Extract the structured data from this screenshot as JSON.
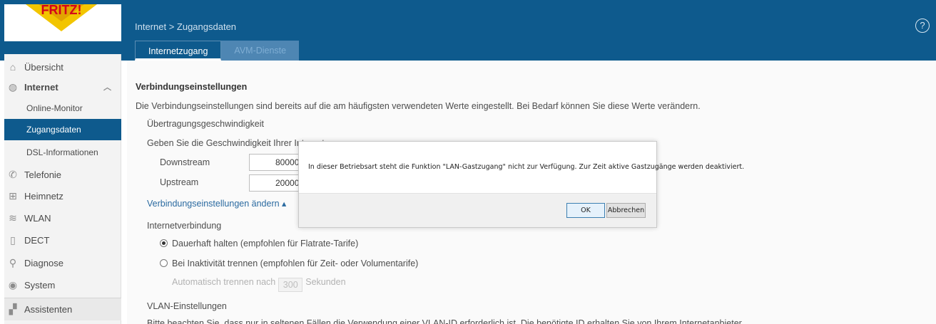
{
  "header": {
    "breadcrumb": "Internet > Zugangsdaten",
    "help_icon": "?",
    "tabs": [
      {
        "label": "Internetzugang",
        "active": true
      },
      {
        "label": "AVM-Dienste",
        "active": false
      }
    ],
    "colors": {
      "brand_blue": "#0e5a8d",
      "tab_inactive": "#4e86b3"
    }
  },
  "sidebar": {
    "items": [
      {
        "label": "Übersicht",
        "icon": "home-icon"
      },
      {
        "label": "Internet",
        "icon": "globe-icon",
        "expanded": true
      },
      {
        "label": "Online-Monitor",
        "sub": true
      },
      {
        "label": "Zugangsdaten",
        "sub": true,
        "active": true
      },
      {
        "label": "DSL-Informationen",
        "sub": true
      },
      {
        "label": "Telefonie",
        "icon": "phone-icon"
      },
      {
        "label": "Heimnetz",
        "icon": "network-icon"
      },
      {
        "label": "WLAN",
        "icon": "wifi-icon"
      },
      {
        "label": "DECT",
        "icon": "dect-icon"
      },
      {
        "label": "Diagnose",
        "icon": "diagnose-icon"
      },
      {
        "label": "System",
        "icon": "system-icon"
      },
      {
        "label": "Assistenten",
        "icon": "wizard-icon"
      }
    ]
  },
  "main": {
    "section_title": "Verbindungseinstellungen",
    "intro": "Die Verbindungseinstellungen sind bereits auf die am häufigsten verwendeten Werte eingestellt. Bei Bedarf können Sie diese Werte verändern.",
    "speed_title": "Übertragungsgeschwindigkeit",
    "speed_hint": "Geben Sie die Geschwindigkeit Ihrer Internetv",
    "downstream_label": "Downstream",
    "downstream_value": "80000",
    "upstream_label": "Upstream",
    "upstream_value": "20000",
    "change_link": "Verbindungseinstellungen ändern ▴",
    "connection_title": "Internetverbindung",
    "radio_keep": "Dauerhaft halten (empfohlen für Flatrate-Tarife)",
    "radio_disconnect": "Bei Inaktivität trennen (empfohlen für Zeit- oder Volumentarife)",
    "auto_disconnect_prefix": "Automatisch trennen nach",
    "auto_disconnect_value": "300",
    "auto_disconnect_suffix": "Sekunden",
    "vlan_title": "VLAN-Einstellungen",
    "vlan_hint": "Bitte beachten Sie, dass nur in seltenen Fällen die Verwendung einer VLAN-ID erforderlich ist. Die benötigte ID erhalten Sie von Ihrem Internetanbieter."
  },
  "dialog": {
    "message": "In dieser Betriebsart steht die Funktion \"LAN-Gastzugang\" nicht zur Verfügung. Zur Zeit aktive Gastzugänge werden deaktiviert.",
    "ok_label": "OK",
    "cancel_label": "Abbrechen"
  }
}
